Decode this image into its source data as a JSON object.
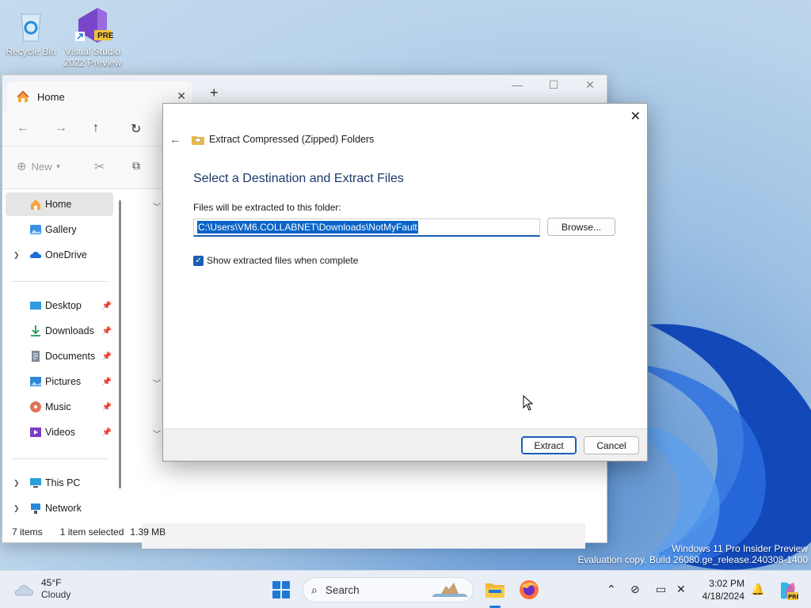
{
  "desktop": {
    "icons": [
      {
        "label": "Recycle Bin"
      },
      {
        "label": "Visual Studio 2022 Preview",
        "badge": "PRE"
      }
    ],
    "watermark": {
      "line1": "Windows 11 Pro Insider Preview",
      "line2": "Evaluation copy. Build 26080.ge_release.240308-1400"
    }
  },
  "explorer": {
    "tab_title": "Home",
    "new_tab_glyph": "+",
    "command_new": "New",
    "sidebar": {
      "items": [
        {
          "label": "Home",
          "icon": "home-icon"
        },
        {
          "label": "Gallery",
          "icon": "gallery-icon"
        },
        {
          "label": "OneDrive",
          "icon": "cloud-icon"
        },
        {
          "label": "Desktop",
          "icon": "desktop-icon"
        },
        {
          "label": "Downloads",
          "icon": "download-icon"
        },
        {
          "label": "Documents",
          "icon": "documents-icon"
        },
        {
          "label": "Pictures",
          "icon": "pictures-icon"
        },
        {
          "label": "Music",
          "icon": "music-icon"
        },
        {
          "label": "Videos",
          "icon": "videos-icon"
        },
        {
          "label": "This PC",
          "icon": "pc-icon"
        },
        {
          "label": "Network",
          "icon": "network-icon"
        }
      ]
    },
    "status": {
      "items": "7 items",
      "selected": "1 item selected",
      "size": "1.39 MB"
    }
  },
  "dialog": {
    "header": "Extract Compressed (Zipped) Folders",
    "title": "Select a Destination and Extract Files",
    "label": "Files will be extracted to this folder:",
    "path": "C:\\Users\\VM6.COLLABNET\\Downloads\\NotMyFault",
    "browse": "Browse...",
    "checkbox_label": "Show extracted files when complete",
    "checkbox_checked": true,
    "extract": "Extract",
    "cancel": "Cancel"
  },
  "taskbar": {
    "weather": {
      "temp": "45°F",
      "condition": "Cloudy"
    },
    "search_label": "Search",
    "time": "3:02 PM",
    "date": "4/18/2024"
  },
  "colors": {
    "accent": "#1a5fb4",
    "selection": "#0a64c8",
    "title_text": "#1c3a6b"
  }
}
